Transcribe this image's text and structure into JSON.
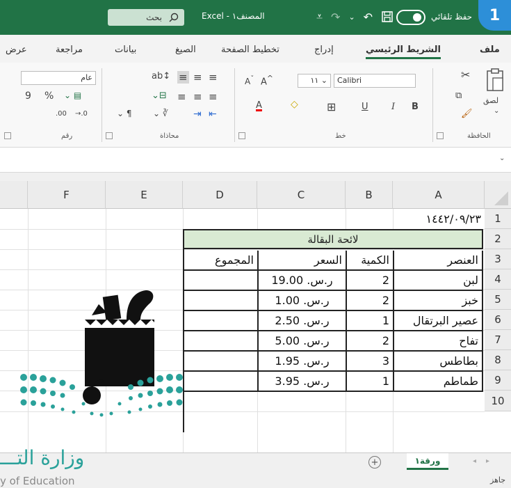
{
  "window": {
    "search_placeholder": "بحث",
    "title": "Excel - المصنف١",
    "autosave_label": "حفظ تلقائي",
    "step_badge": "1"
  },
  "tabs": [
    {
      "label": "ملف"
    },
    {
      "label": "الشريط الرئيسي"
    },
    {
      "label": "إدراج"
    },
    {
      "label": "تخطيط الصفحة"
    },
    {
      "label": "الصيغ"
    },
    {
      "label": "بيانات"
    },
    {
      "label": "مراجعة"
    },
    {
      "label": "عرض"
    }
  ],
  "ribbon": {
    "groups": {
      "clipboard": "الحافظة",
      "font": "خط",
      "alignment": "محاذاة",
      "number": "رقم"
    },
    "paste_label": "لصق",
    "font_name": "Calibri",
    "font_size": "١١",
    "number_format": "عام",
    "bold": "B",
    "italic": "I",
    "underline": "U",
    "percent": "%",
    "comma": "9",
    "inc_decimal": ".00",
    "dec_decimal": "→.0",
    "grow_font": "A",
    "shrink_font": "A"
  },
  "grid": {
    "columns": [
      "A",
      "B",
      "C",
      "D",
      "E",
      "F"
    ],
    "rows": [
      "1",
      "2",
      "3",
      "4",
      "5",
      "6",
      "7",
      "8",
      "9",
      "10"
    ],
    "a1": "١٤٤٢/٠٩/٢٣",
    "table_title": "لائحة البقالة",
    "headers": {
      "item": "العنصر",
      "qty": "الكمية",
      "price": "السعر",
      "total": "المجموع"
    },
    "items": [
      {
        "name": "لبن",
        "qty": "2",
        "price": "ر.س. 19.00"
      },
      {
        "name": "خبز",
        "qty": "2",
        "price": "ر.س. 1.00"
      },
      {
        "name": "عصير البرتقال",
        "qty": "1",
        "price": "ر.س. 2.50"
      },
      {
        "name": "تفاح",
        "qty": "2",
        "price": "ر.س. 5.00"
      },
      {
        "name": "بطاطس",
        "qty": "3",
        "price": "ر.س. 1.95"
      },
      {
        "name": "طماطم",
        "qty": "1",
        "price": "ر.س. 3.95"
      }
    ]
  },
  "sheets": {
    "active": "ورقة١",
    "add": "+"
  },
  "status": {
    "ready": "جاهز"
  },
  "watermark": {
    "arabic": "وزارة التـــ",
    "english": "y of Education"
  }
}
